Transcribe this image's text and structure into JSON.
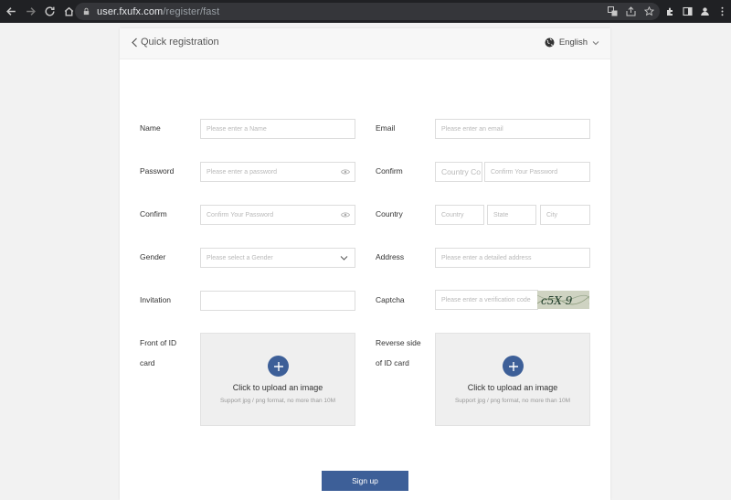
{
  "browser": {
    "url_domain": "user.fxufx.com",
    "url_path": "/register/fast"
  },
  "header": {
    "back_label": "Quick registration",
    "language": "English"
  },
  "form": {
    "name": {
      "label": "Name",
      "placeholder": "Please enter a Name"
    },
    "email": {
      "label": "Email",
      "placeholder": "Please enter an email"
    },
    "password": {
      "label": "Password",
      "placeholder": "Please enter a password"
    },
    "confirm_country_code": {
      "label": "Confirm",
      "placeholder": "Country Co",
      "placeholder2": "Confirm Your Password"
    },
    "confirm_password": {
      "label": "Confirm",
      "placeholder": "Confirm Your Password"
    },
    "country": {
      "label": "Country",
      "country_placeholder": "Country",
      "state_placeholder": "State",
      "city_placeholder": "City"
    },
    "gender": {
      "label": "Gender",
      "placeholder": "Please select a Gender"
    },
    "address": {
      "label": "Address",
      "placeholder": "Please enter a detailed address"
    },
    "invitation": {
      "label": "Invitation",
      "value": ""
    },
    "captcha": {
      "label": "Captcha",
      "placeholder": "Please enter a verification code",
      "image_text": "c5X 9"
    },
    "id_front": {
      "label_line1": "Front of ID",
      "label_line2": "card",
      "title": "Click to upload an image",
      "hint": "Support jpg / png format, no more than 10M"
    },
    "id_back": {
      "label_line1": "Reverse side",
      "label_line2": "of ID card",
      "title": "Click to upload an image",
      "hint": "Support jpg / png format, no more than 10M"
    },
    "submit_label": "Sign up"
  },
  "colors": {
    "primary": "#3d5f98",
    "chrome_bg": "#202124"
  }
}
